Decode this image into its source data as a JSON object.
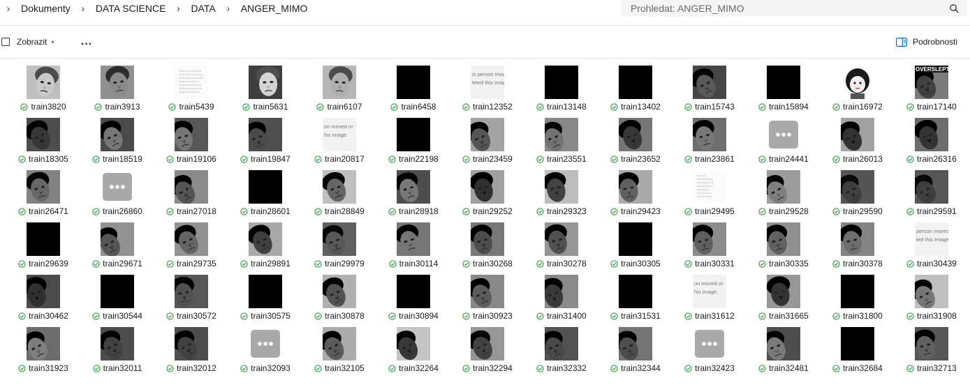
{
  "address_bar": {
    "breadcrumb": [
      "Dokumenty",
      "DATA SCIENCE",
      "DATA",
      "ANGER_MIMO"
    ],
    "search_placeholder": "Prohledat: ANGER_MIMO"
  },
  "toolbar": {
    "view_label": "Zobrazit",
    "more_label": "...",
    "details_label": "Podrobnosti"
  },
  "colors": {
    "sync_ok": "#2f9e44",
    "accent": "#0067c0"
  },
  "files": [
    [
      "train3820",
      "train3913",
      "train5439",
      "train5631",
      "train6107",
      "train6458",
      "train12352",
      "train13148",
      "train13402",
      "train15743",
      "train15894",
      "train16972",
      "train17140"
    ],
    [
      "train18305",
      "train18519",
      "train19106",
      "train19847",
      "train20817",
      "train22198",
      "train23459",
      "train23551",
      "train23652",
      "train23861",
      "train24441",
      "train26013",
      "train26316"
    ],
    [
      "train26471",
      "train26860",
      "train27018",
      "train28601",
      "train28849",
      "train28918",
      "train29252",
      "train29323",
      "train29423",
      "train29495",
      "train29528",
      "train29590",
      "train29591"
    ],
    [
      "train29639",
      "train29671",
      "train29735",
      "train29891",
      "train29979",
      "train30114",
      "train30268",
      "train30278",
      "train30305",
      "train30331",
      "train30335",
      "train30378",
      "train30439"
    ],
    [
      "train30462",
      "train30544",
      "train30572",
      "train30575",
      "train30878",
      "train30894",
      "train30923",
      "train31400",
      "train31531",
      "train31612",
      "train31665",
      "train31800",
      "train31908"
    ],
    [
      "train31923",
      "train32011",
      "train32012",
      "train32093",
      "train32105",
      "train32264",
      "train32294",
      "train32332",
      "train32344",
      "train32423",
      "train32481",
      "train32684",
      "train32713"
    ]
  ],
  "thumb_kinds": [
    [
      "face",
      "face",
      "doc",
      "face",
      "face",
      "black",
      "text",
      "black",
      "black",
      "face",
      "black",
      "cartoon",
      "face"
    ],
    [
      "face",
      "face",
      "face",
      "face",
      "text",
      "black",
      "face",
      "face",
      "face",
      "face",
      "dots",
      "face",
      "face"
    ],
    [
      "face",
      "dots",
      "face",
      "black",
      "face",
      "face",
      "face",
      "face",
      "face",
      "doc",
      "face",
      "face",
      "face"
    ],
    [
      "black",
      "face",
      "face",
      "face",
      "face",
      "face",
      "face",
      "face",
      "black",
      "face",
      "face",
      "face",
      "text"
    ],
    [
      "face",
      "black",
      "face",
      "black",
      "face",
      "black",
      "face",
      "face",
      "black",
      "text",
      "face",
      "black",
      "face"
    ],
    [
      "face",
      "face",
      "face",
      "dots",
      "face",
      "face",
      "face",
      "face",
      "face",
      "dots",
      "face",
      "black",
      "face"
    ]
  ],
  "thumb_text": {
    "t12352": [
      "is person moved or",
      "leted this image."
    ],
    "t20817": [
      "on moved or",
      "his image."
    ],
    "t30439": [
      "person moved or",
      "ted this image."
    ],
    "t31612": [
      "on moved or",
      "his image."
    ],
    "t17140": "OVERSLEPT"
  }
}
